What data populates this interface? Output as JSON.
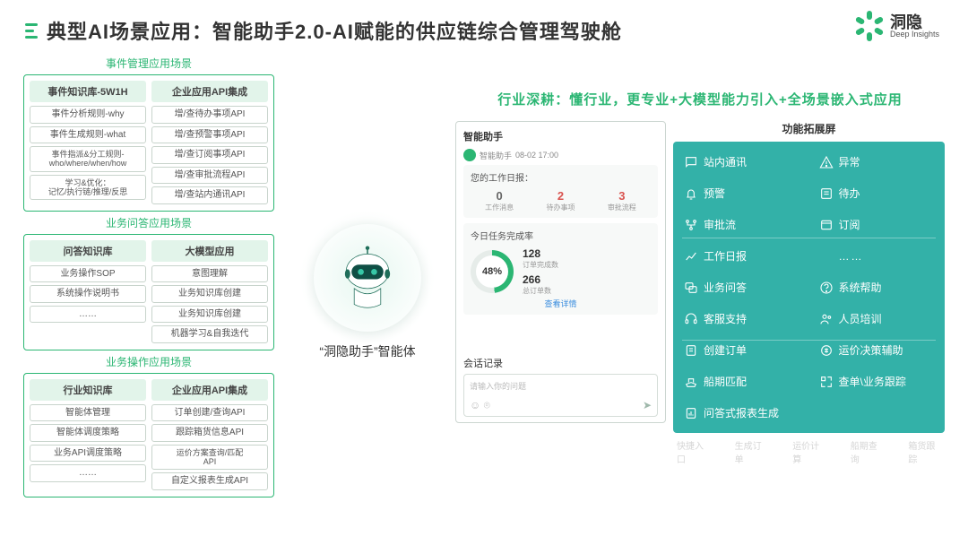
{
  "header": {
    "title": "典型AI场景应用：智能助手2.0-AI赋能的供应链综合管理驾驶舱"
  },
  "logo": {
    "cn": "洞隐",
    "en": "Deep Insights"
  },
  "sections": [
    {
      "title": "事件管理应用场景",
      "cols": [
        {
          "head": "事件知识库-5W1H",
          "items": [
            "事件分析规则-why",
            "事件生成规则-what",
            "事件指派&分工规则-\nwho/where/when/how",
            "学习&优化：\n记忆/执行链/推理/反思"
          ]
        },
        {
          "head": "企业应用API集成",
          "items": [
            "增/查待办事项API",
            "增/查预警事项API",
            "增/查订阅事项API",
            "增/查审批流程API",
            "增/查站内通讯API"
          ]
        }
      ]
    },
    {
      "title": "业务问答应用场景",
      "cols": [
        {
          "head": "问答知识库",
          "items": [
            "业务操作SOP",
            "系统操作说明书",
            "……"
          ]
        },
        {
          "head": "大模型应用",
          "items": [
            "意图理解",
            "业务知识库创建",
            "业务知识库创建",
            "机器学习&自我迭代"
          ]
        }
      ]
    },
    {
      "title": "业务操作应用场景",
      "cols": [
        {
          "head": "行业知识库",
          "items": [
            "智能体管理",
            "智能体调度策略",
            "业务API调度策略",
            "……"
          ]
        },
        {
          "head": "企业应用API集成",
          "items": [
            "订单创建/查询API",
            "跟踪箱货信息API",
            "运价方案查询/匹配\nAPI",
            "自定义报表生成API"
          ]
        }
      ]
    }
  ],
  "center": {
    "caption_pre": "“洞隐助手”",
    "caption_post": "智能体"
  },
  "right": {
    "headline": "行业深耕：懂行业，更专业+大模型能力引入+全场景嵌入式应用",
    "phone": {
      "title": "智能助手",
      "bot_name": "智能助手",
      "timestamp": "08-02 17:00",
      "card1_title": "您的工作日报：",
      "stats": [
        {
          "num": "0",
          "label": "工作消息",
          "color": ""
        },
        {
          "num": "2",
          "label": "待办事项",
          "color": "red"
        },
        {
          "num": "3",
          "label": "审批流程",
          "color": "red"
        }
      ],
      "card2_title": "今日任务完成率",
      "gauge": "48%",
      "mini": [
        {
          "n": "128",
          "l": "订单完成数"
        },
        {
          "n": "266",
          "l": "总订单数"
        }
      ],
      "detail_link": "查看详情",
      "session_title": "会话记录",
      "placeholder": "请输入你的问题"
    },
    "features": {
      "title": "功能拓展屏",
      "group_a": [
        {
          "icon": "chat",
          "label": "站内通讯"
        },
        {
          "icon": "alert",
          "label": "异常"
        },
        {
          "icon": "bell",
          "label": "预警"
        },
        {
          "icon": "list",
          "label": "待办"
        },
        {
          "icon": "flow",
          "label": "审批流"
        },
        {
          "icon": "sub",
          "label": "订阅"
        },
        {
          "icon": "chart",
          "label": "工作日报"
        }
      ],
      "group_b": [
        {
          "icon": "qa",
          "label": "业务问答"
        },
        {
          "icon": "help",
          "label": "系统帮助"
        },
        {
          "icon": "support",
          "label": "客服支持"
        },
        {
          "icon": "train",
          "label": "人员培训"
        }
      ],
      "group_c": [
        {
          "icon": "order",
          "label": "创建订单"
        },
        {
          "icon": "price",
          "label": "运价决策辅助"
        },
        {
          "icon": "ship",
          "label": "船期匹配"
        },
        {
          "icon": "track",
          "label": "查单\\业务跟踪"
        },
        {
          "icon": "report",
          "label": "问答式报表生成"
        }
      ],
      "ghosts": [
        "快捷入口",
        "生成订单",
        "运价计算",
        "船期查询",
        "箱货跟踪"
      ]
    }
  }
}
